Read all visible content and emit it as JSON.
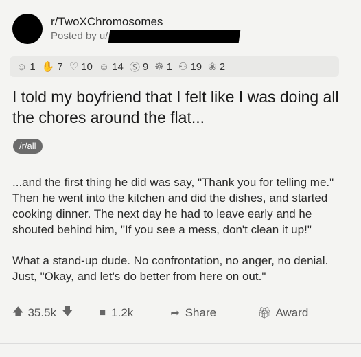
{
  "post": {
    "subreddit": "r/TwoXChromosomes",
    "posted_by": "Posted by u/",
    "title": "I told my boyfriend that I felt like I was doing all the chores around the flat...",
    "flair": "/r/all",
    "body": [
      "...and the first thing he did was say, \"Thank you for telling me.\" Then he went into the kitchen and did the dishes, and started cooking dinner.  The next day he had to leave early and he shouted behind him, \"If you see a mess, don't clean it up!\"",
      "What a stand-up dude. No confrontation, no anger, no denial. Just, \"Okay, and let's do better from here on out.\""
    ]
  },
  "awards": [
    {
      "icon": "award-icon-1",
      "glyph": "☺",
      "count": "1"
    },
    {
      "icon": "award-icon-2",
      "glyph": "✋",
      "count": "7"
    },
    {
      "icon": "award-icon-3",
      "glyph": "♡",
      "count": "10"
    },
    {
      "icon": "award-icon-4",
      "glyph": "☺",
      "count": "14"
    },
    {
      "icon": "award-icon-5",
      "glyph": "Ⓢ",
      "count": "9"
    },
    {
      "icon": "award-icon-6",
      "glyph": "☸",
      "count": "1"
    },
    {
      "icon": "award-icon-7",
      "glyph": "⚇",
      "count": "19"
    },
    {
      "icon": "award-icon-8",
      "glyph": "❀",
      "count": "2"
    }
  ],
  "actions": {
    "score": "35.5k",
    "comments": "1.2k",
    "share": "Share",
    "award": "Award"
  }
}
